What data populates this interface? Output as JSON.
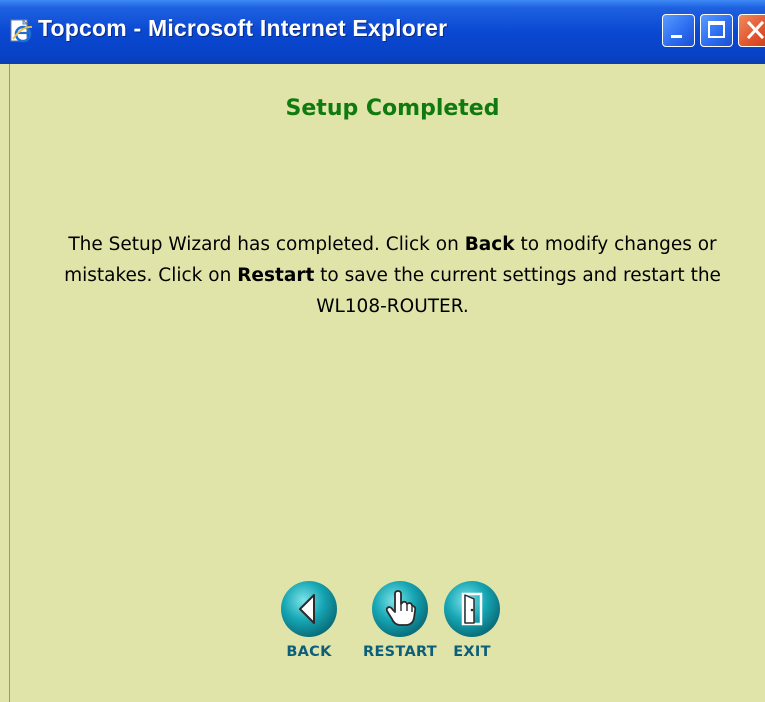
{
  "window": {
    "title": "Topcom - Microsoft Internet Explorer"
  },
  "page": {
    "heading": "Setup Completed",
    "message": {
      "part1": "The Setup Wizard has completed. Click on ",
      "back_word": "Back",
      "part2": " to modify changes or mistakes. Click on ",
      "restart_word": "Restart",
      "part3": " to save the current settings and restart the WL108-ROUTER."
    }
  },
  "buttons": {
    "back_label": "BACK",
    "restart_label": "RESTART",
    "exit_label": "EXIT"
  },
  "icons": {
    "app": "ie-page-icon",
    "back": "arrow-left-icon",
    "restart": "hand-pointer-icon",
    "exit": "door-exit-icon",
    "minimize": "minimize-icon",
    "maximize": "maximize-icon",
    "close": "close-icon"
  },
  "colors": {
    "page_background": "#e1e4a8",
    "heading": "#0f7a0f",
    "button_circle": "#16a6b4",
    "button_label": "#0b5f7a",
    "titlebar": "#0a48d2"
  }
}
